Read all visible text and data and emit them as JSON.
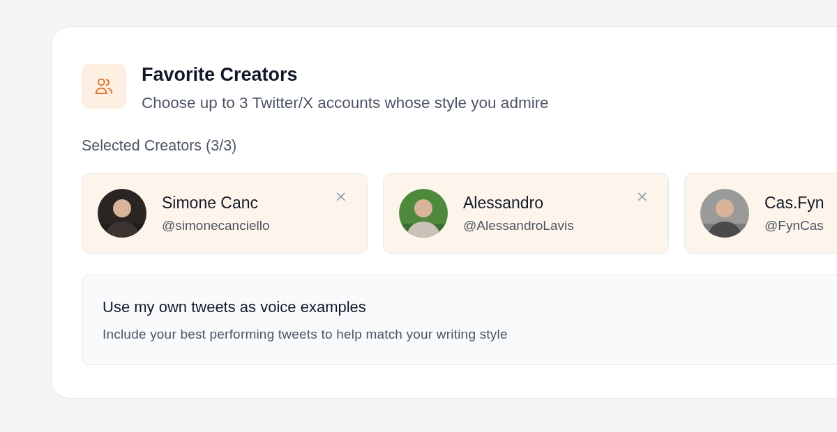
{
  "header": {
    "title": "Favorite Creators",
    "subtitle": "Choose up to 3 Twitter/X accounts whose style you admire"
  },
  "selected_label": "Selected Creators (3/3)",
  "creators": [
    {
      "name": "Simone Canc",
      "handle": "@simonecanciello",
      "close": "×"
    },
    {
      "name": "Alessandro",
      "handle": "@AlessandroLavis",
      "close": "×"
    },
    {
      "name": "Cas.Fyn",
      "handle": "@FynCas"
    }
  ],
  "own_tweets": {
    "title": "Use my own tweets as voice examples",
    "description": "Include your best performing tweets to help match your writing style"
  }
}
